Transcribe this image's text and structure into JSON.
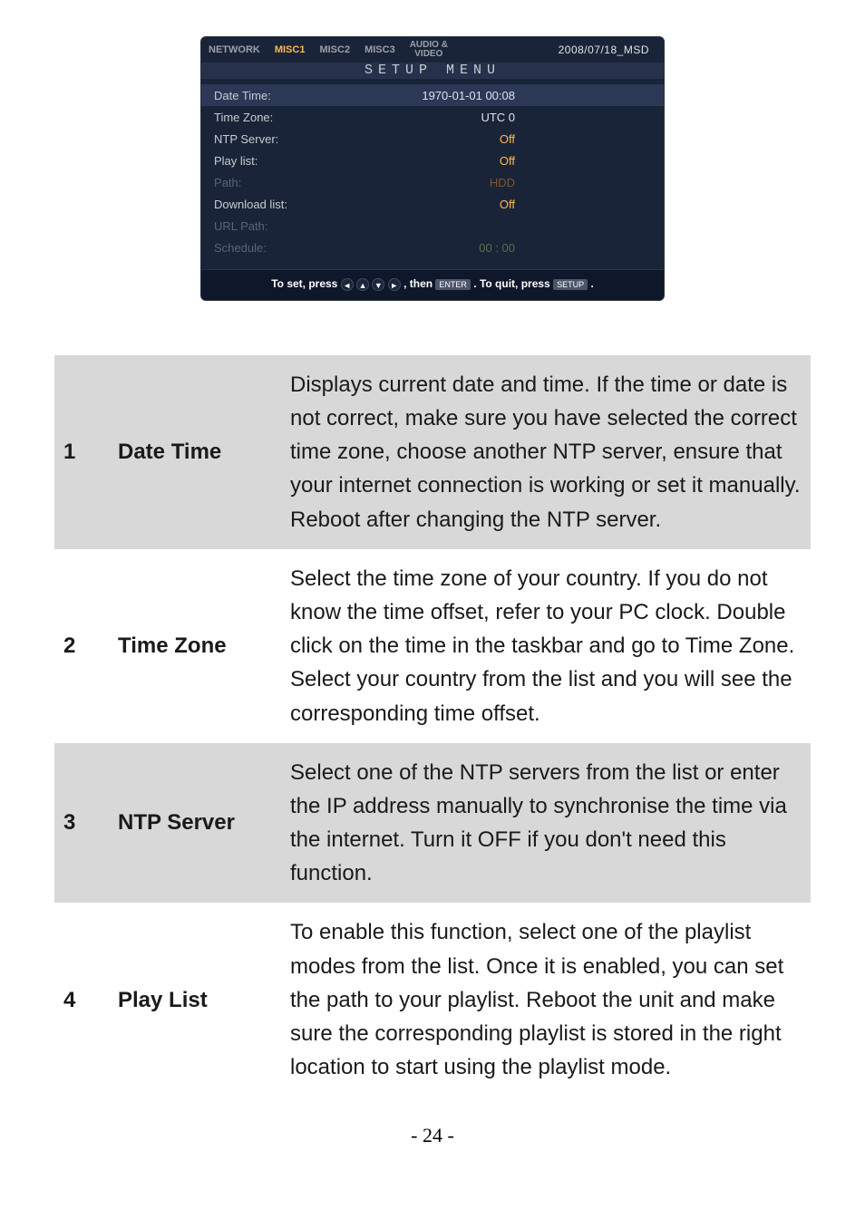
{
  "screenshot": {
    "tabs": {
      "network": "NETWORK",
      "misc1": "MISC1",
      "misc2": "MISC2",
      "misc3": "MISC3",
      "audio_video": "AUDIO &\nVIDEO",
      "date": "2008/07/18_MSD"
    },
    "title": "SETUP MENU",
    "rows": {
      "date_time": {
        "label": "Date Time:",
        "value": "1970-01-01 00:08"
      },
      "time_zone": {
        "label": "Time Zone:",
        "value": "UTC 0"
      },
      "ntp_server": {
        "label": "NTP Server:",
        "value": "Off"
      },
      "play_list": {
        "label": "Play list:",
        "value": "Off"
      },
      "path": {
        "label": "Path:",
        "value": "HDD"
      },
      "download_list": {
        "label": "Download list:",
        "value": "Off"
      },
      "url_path": {
        "label": "URL Path:",
        "value": ""
      },
      "schedule": {
        "label": "Schedule:",
        "value": "00 : 00"
      }
    },
    "footer": {
      "prefix": "To set, press ",
      "mid": ", then ",
      "enter": "ENTER",
      "tail1": " . To quit, press ",
      "setup": "SETUP",
      "tail2": " ."
    }
  },
  "items": [
    {
      "num": "1",
      "name": "Date Time",
      "text": "Displays current date and time. If the time or date is not correct, make sure you have selected the correct time zone, choose another NTP server, ensure that your internet connection is working or set it manually. Reboot after changing the NTP server."
    },
    {
      "num": "2",
      "name": "Time Zone",
      "text": "Select the time zone of your country. If you do not know the time offset, refer to your PC clock. Double click on the time in the taskbar and go to Time Zone. Select your country from the list and you will see the corresponding time offset."
    },
    {
      "num": "3",
      "name": "NTP Server",
      "text": "Select one of the NTP servers from the list or enter the IP address manually to synchronise the time via the internet. Turn it OFF if you don't need this function."
    },
    {
      "num": "4",
      "name": "Play List",
      "text": "To enable this function, select one of the playlist modes from the list. Once it is enabled, you can set the path to your playlist. Reboot the unit and make sure the corresponding playlist is stored in the right location to start using the playlist mode."
    }
  ],
  "page_number": "- 24 -"
}
